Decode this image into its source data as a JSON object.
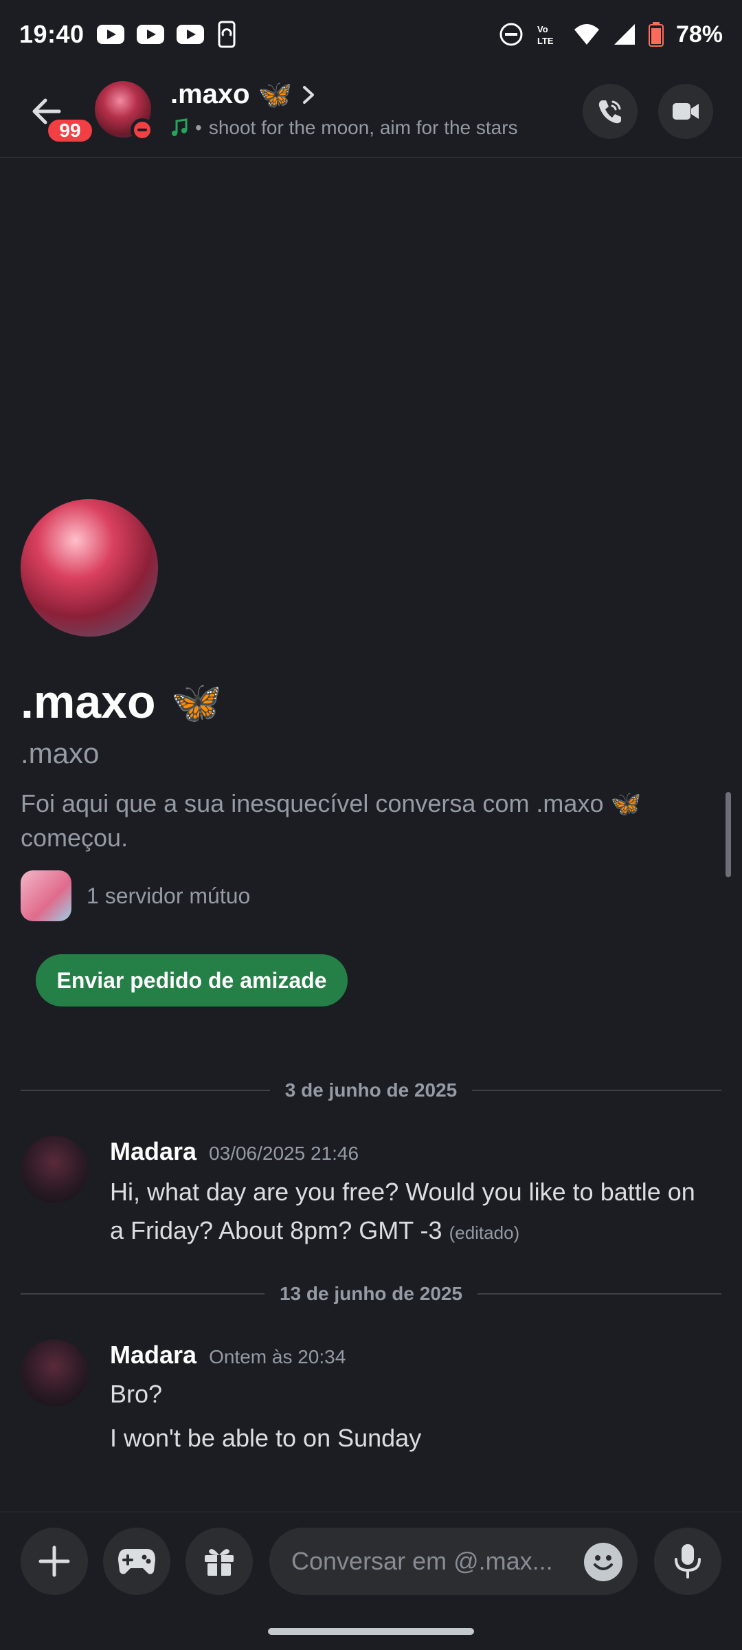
{
  "status_bar": {
    "time": "19:40",
    "battery": "78%",
    "icons": [
      "youtube-icon",
      "youtube-icon",
      "youtube-icon",
      "phone-sync-icon",
      "dnd-icon",
      "volte-icon",
      "wifi-icon",
      "signal-icon",
      "battery-icon"
    ]
  },
  "header": {
    "unread_badge": "99",
    "name": ".maxo",
    "name_emoji": "🦋",
    "status": "shoot for the moon, aim for the stars",
    "status_separator": "•",
    "status_dot_color": "#f23f43"
  },
  "profile": {
    "display_name": ".maxo",
    "display_emoji": "🦋",
    "username": ".maxo",
    "intro": "Foi aqui que a sua inesquecível conversa com .maxo 🦋 começou.",
    "mutual_servers": "1 servidor mútuo",
    "friend_request_button": "Enviar pedido de amizade"
  },
  "messages": {
    "dividers": [
      "3 de junho de 2025",
      "13 de junho de 2025"
    ],
    "groups": [
      {
        "author": "Madara",
        "timestamp": "03/06/2025 21:46",
        "lines": [
          "Hi, what day are you free? Would you like to battle on a Friday? About 8pm? GMT -3"
        ],
        "edited_label": "(editado)"
      },
      {
        "author": "Madara",
        "timestamp": "Ontem às 20:34",
        "lines": [
          "Bro?",
          "I won't be able to on Sunday"
        ]
      }
    ]
  },
  "composer": {
    "placeholder": "Conversar em @.max..."
  },
  "colors": {
    "background": "#1c1d22",
    "accent_green": "#248046",
    "badge_red": "#f23f43"
  }
}
